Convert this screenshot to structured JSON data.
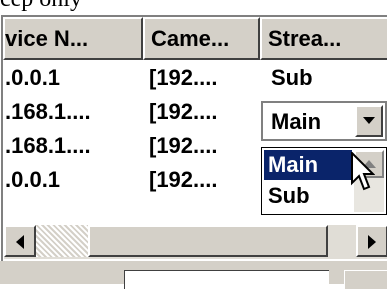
{
  "top_text": "cep only",
  "list": {
    "headers": [
      "vice N...",
      "Came...",
      "Strea..."
    ],
    "rows": [
      {
        "device": ".0.0.1",
        "camera": "[192....",
        "stream": "Sub"
      },
      {
        "device": ".168.1....",
        "camera": "[192....",
        "stream": "Main"
      },
      {
        "device": ".168.1....",
        "camera": "[192....",
        "stream": ""
      },
      {
        "device": ".0.0.1",
        "camera": "[192....",
        "stream": ""
      }
    ]
  },
  "stream_combo": {
    "selected": "Main",
    "options": [
      "Main",
      "Sub"
    ],
    "highlighted": "Main"
  },
  "icons": {
    "combo_arrow": "chevron-down-icon",
    "dropdown_scroll_up": "scroll-up-arrow-icon",
    "scroll_left": "scroll-left-arrow-icon",
    "scroll_right": "scroll-right-arrow-icon",
    "cursor": "mouse-pointer-icon"
  },
  "colors": {
    "face": "#d4d0c8",
    "highlight": "#0a246a",
    "window": "#ffffff"
  }
}
